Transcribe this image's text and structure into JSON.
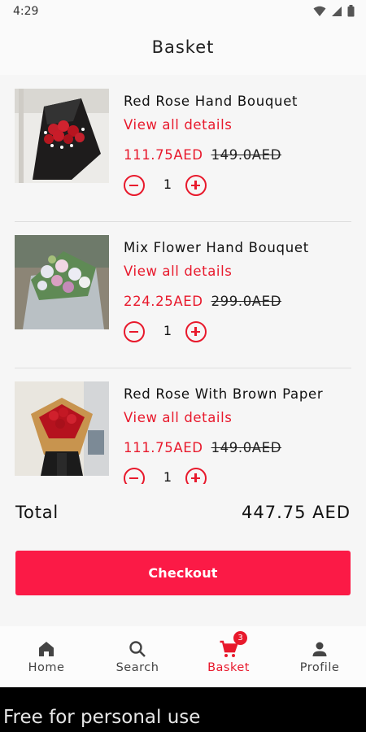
{
  "status_bar": {
    "time": "4:29"
  },
  "header": {
    "title": "Basket"
  },
  "items": [
    {
      "name": "Red Rose Hand Bouquet",
      "details_link": "View all details",
      "price": "111.75AED",
      "old_price": "149.0AED",
      "quantity": "1"
    },
    {
      "name": "Mix Flower Hand Bouquet",
      "details_link": "View all details",
      "price": "224.25AED",
      "old_price": "299.0AED",
      "quantity": "1"
    },
    {
      "name": "Red Rose With Brown Paper",
      "details_link": "View all details",
      "price": "111.75AED",
      "old_price": "149.0AED",
      "quantity": "1"
    }
  ],
  "summary": {
    "total_label": "Total",
    "total_value": "447.75 AED"
  },
  "checkout": {
    "label": "Checkout"
  },
  "bottom_nav": {
    "items": [
      {
        "label": "Home",
        "icon": "home-icon"
      },
      {
        "label": "Search",
        "icon": "search-icon"
      },
      {
        "label": "Basket",
        "icon": "cart-icon",
        "active": true,
        "badge": "3"
      },
      {
        "label": "Profile",
        "icon": "person-icon"
      }
    ]
  },
  "footer": {
    "text": "Free for personal use"
  },
  "colors": {
    "accent": "#e8192c",
    "checkout_button": "#fb1a46",
    "background": "#f6f6f6"
  }
}
